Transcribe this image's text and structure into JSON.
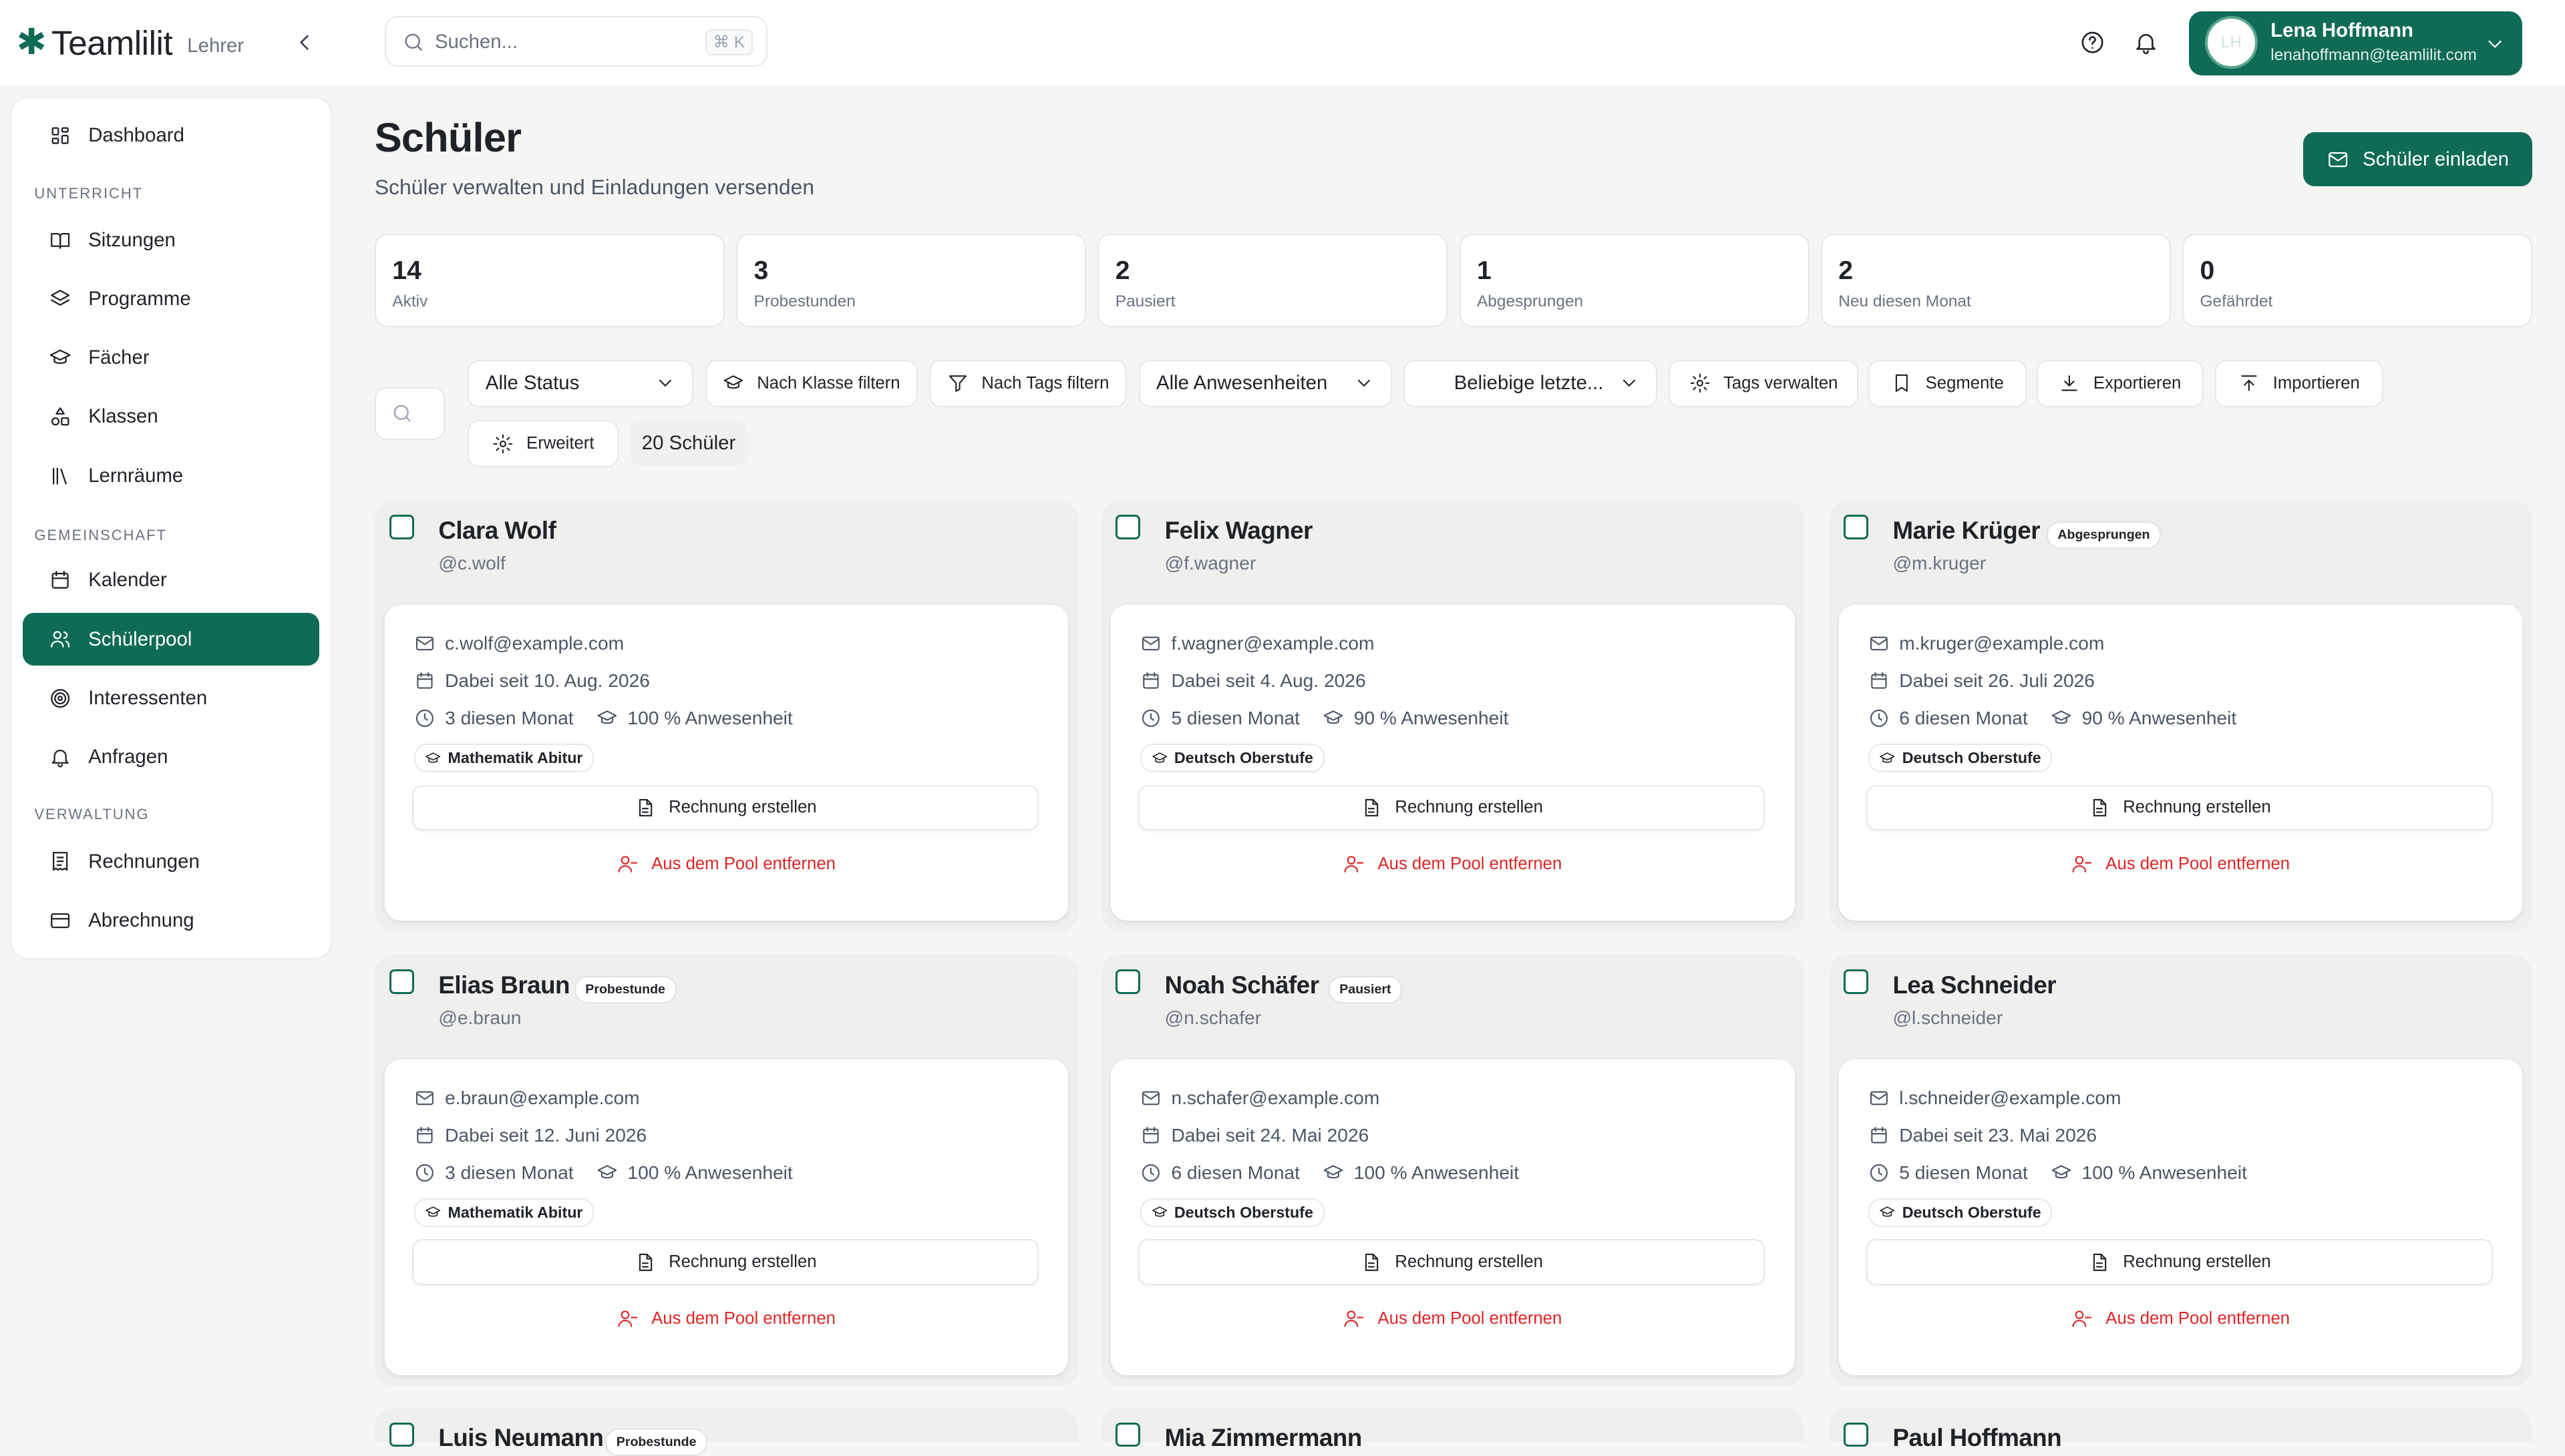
{
  "app": {
    "logo": "✱",
    "name": "Teamlilit",
    "role": "Lehrer"
  },
  "search": {
    "placeholder": "Suchen...",
    "shortcut": "⌘ K"
  },
  "user": {
    "initials": "LH",
    "name": "Lena Hoffmann",
    "email": "lenahoffmann@teamlilit.com"
  },
  "sidebar": {
    "dashboard": "Dashboard",
    "section_teaching": "UNTERRICHT",
    "sessions": "Sitzungen",
    "programs": "Programme",
    "subjects": "Fächer",
    "classes": "Klassen",
    "rooms": "Lernräume",
    "section_community": "GEMEINSCHAFT",
    "calendar": "Kalender",
    "pool": "Schülerpool",
    "prospects": "Interessenten",
    "requests": "Anfragen",
    "section_admin": "VERWALTUNG",
    "invoices": "Rechnungen",
    "billing": "Abrechnung"
  },
  "page": {
    "title": "Schüler",
    "subtitle": "Schüler verwalten und Einladungen versenden",
    "invite_label": "Schüler einladen"
  },
  "stats": [
    {
      "value": "14",
      "label": "Aktiv"
    },
    {
      "value": "3",
      "label": "Probestunden"
    },
    {
      "value": "2",
      "label": "Pausiert"
    },
    {
      "value": "1",
      "label": "Abgesprungen"
    },
    {
      "value": "2",
      "label": "Neu diesen Monat"
    },
    {
      "value": "0",
      "label": "Gefährdet"
    }
  ],
  "filters": {
    "status": "Alle Status",
    "by_class": "Nach Klasse filtern",
    "by_tags": "Nach Tags filtern",
    "attendance": "Alle Anwesenheiten",
    "last": "Beliebige letzte...",
    "manage_tags": "Tags verwalten",
    "segments": "Segmente",
    "export": "Exportieren",
    "import": "Importieren",
    "advanced": "Erweitert",
    "count": "20 Schüler"
  },
  "card_actions": {
    "invoice": "Rechnung erstellen",
    "remove": "Aus dem Pool entfernen"
  },
  "students": [
    {
      "name": "Clara Wolf",
      "handle": "@c.wolf",
      "badge": "",
      "email": "c.wolf@example.com",
      "since": "Dabei seit 10. Aug. 2026",
      "month": "3 diesen Monat",
      "attendance": "100 % Anwesenheit",
      "tag": "Mathematik Abitur"
    },
    {
      "name": "Felix Wagner",
      "handle": "@f.wagner",
      "badge": "",
      "email": "f.wagner@example.com",
      "since": "Dabei seit 4. Aug. 2026",
      "month": "5 diesen Monat",
      "attendance": "90 % Anwesenheit",
      "tag": "Deutsch Oberstufe"
    },
    {
      "name": "Marie Krüger",
      "handle": "@m.kruger",
      "badge": "Abgesprungen",
      "email": "m.kruger@example.com",
      "since": "Dabei seit 26. Juli 2026",
      "month": "6 diesen Monat",
      "attendance": "90 % Anwesenheit",
      "tag": "Deutsch Oberstufe"
    },
    {
      "name": "Elias Braun",
      "handle": "@e.braun",
      "badge": "Probestunde",
      "email": "e.braun@example.com",
      "since": "Dabei seit 12. Juni 2026",
      "month": "3 diesen Monat",
      "attendance": "100 % Anwesenheit",
      "tag": "Mathematik Abitur"
    },
    {
      "name": "Noah Schäfer",
      "handle": "@n.schafer",
      "badge": "Pausiert",
      "email": "n.schafer@example.com",
      "since": "Dabei seit 24. Mai 2026",
      "month": "6 diesen Monat",
      "attendance": "100 % Anwesenheit",
      "tag": "Deutsch Oberstufe"
    },
    {
      "name": "Lea Schneider",
      "handle": "@l.schneider",
      "badge": "",
      "email": "l.schneider@example.com",
      "since": "Dabei seit 23. Mai 2026",
      "month": "5 diesen Monat",
      "attendance": "100 % Anwesenheit",
      "tag": "Deutsch Oberstufe"
    },
    {
      "name": "Luis Neumann",
      "handle": "",
      "badge": "Probestunde",
      "email": "",
      "since": "",
      "month": "",
      "attendance": "",
      "tag": ""
    },
    {
      "name": "Mia Zimmermann",
      "handle": "",
      "badge": "",
      "email": "",
      "since": "",
      "month": "",
      "attendance": "",
      "tag": ""
    },
    {
      "name": "Paul Hoffmann",
      "handle": "",
      "badge": "",
      "email": "",
      "since": "",
      "month": "",
      "attendance": "",
      "tag": ""
    }
  ],
  "colors": {
    "primary": "#0f6b55",
    "danger": "#dc2626",
    "background": "#f5f5f4"
  }
}
